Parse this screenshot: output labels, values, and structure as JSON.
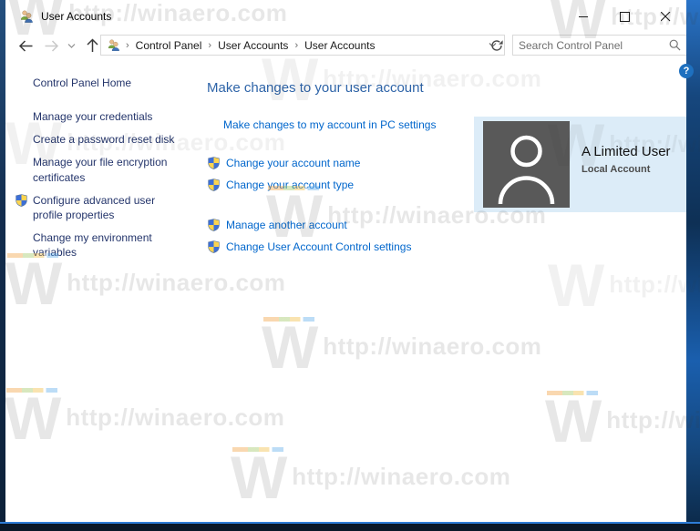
{
  "window": {
    "title": "User Accounts"
  },
  "icons": {
    "breadcrumb_chevron": "›",
    "dropdown_chevron": "⌄",
    "help": "?"
  },
  "toolbar": {
    "search_placeholder": "Search Control Panel"
  },
  "breadcrumb": {
    "items": [
      "Control Panel",
      "User Accounts",
      "User Accounts"
    ]
  },
  "sidebar": {
    "home": "Control Panel Home",
    "items": [
      {
        "label": "Manage your credentials"
      },
      {
        "label": "Create a password reset disk"
      },
      {
        "label": "Manage your file encryption certificates"
      },
      {
        "label": "Configure advanced user profile properties"
      },
      {
        "label": "Change my environment variables"
      }
    ]
  },
  "main": {
    "heading": "Make changes to your user account",
    "pc_settings_link": "Make changes to my account in PC settings",
    "account_links": [
      "Change your account name",
      "Change your account type"
    ],
    "admin_links": [
      "Manage another account",
      "Change User Account Control settings"
    ]
  },
  "user_tile": {
    "name": "A Limited User",
    "account_type": "Local Account"
  },
  "watermark": {
    "letter": "W",
    "text": "http://winaero.com"
  }
}
